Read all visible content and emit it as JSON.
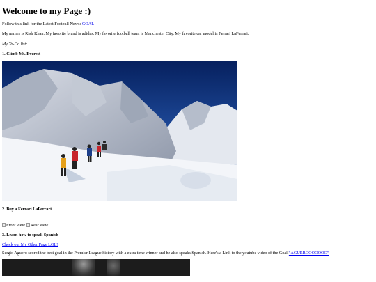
{
  "page": {
    "title": "Welcome to my Page :)",
    "news_prefix": "Follow this link for the Latest Football News: ",
    "news_link": "GOAL",
    "bio": "My names is Rish Khan. My favorite brand is adidas. My favorite football team is Manchester City. My favorite car model is Ferrari LaFerrari.",
    "todo_label": "My To-Do list:",
    "item1": "1. Climb Mt. Everest",
    "item2": "2. Buy a Ferrari LaFerrari",
    "front_alt": "Front view",
    "rear_alt": "Rear view",
    "item3": "3. Learn how to speak Spanish",
    "other_page_link": "Check out My Other Page LOL!",
    "aguero_text": "Sergio Aguero scored the best goal in the Premier League history with a extra time winner and he also speaks Spanish. Here's a Link to the youtube video of the Goal!",
    "aguero_link": "\"AGUEROOOOOOO\""
  },
  "colors": {
    "link": "#0000ee",
    "sky": "#0c2a6b",
    "snow": "#f2f4f8"
  }
}
